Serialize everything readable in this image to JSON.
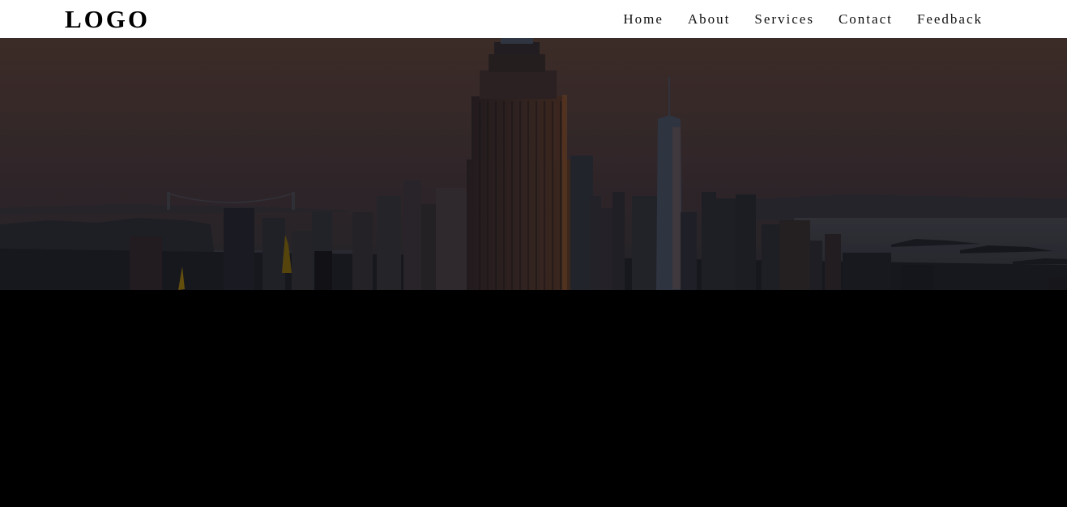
{
  "header": {
    "logo": "LOGO",
    "nav": [
      {
        "label": "Home"
      },
      {
        "label": "About"
      },
      {
        "label": "Services"
      },
      {
        "label": "Contact"
      },
      {
        "label": "Feedback"
      }
    ]
  },
  "hero": {
    "image_subject": "city skyline at dusk"
  },
  "colors": {
    "header_bg": "#ffffff",
    "page_bg": "#000000",
    "sky_top": "#4a3630",
    "sky_bottom": "#2c2a30"
  }
}
